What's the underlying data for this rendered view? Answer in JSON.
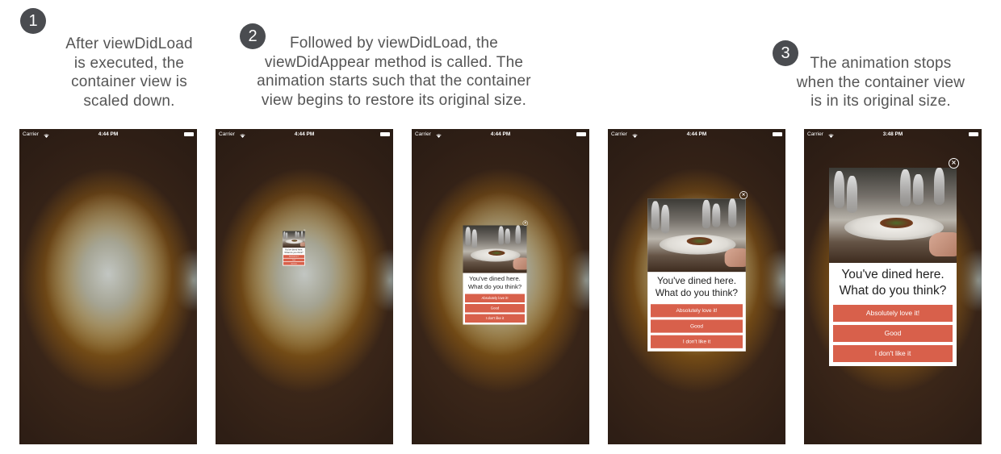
{
  "steps": [
    {
      "number": "1",
      "caption_lines": [
        "After viewDidLoad",
        "is executed, the",
        "container view is",
        "scaled down."
      ]
    },
    {
      "number": "2",
      "caption_lines": [
        "Followed by viewDidLoad, the",
        "viewDidAppear method is called. The",
        "animation starts such that the container",
        "view begins to restore its original size."
      ]
    },
    {
      "number": "3",
      "caption_lines": [
        "The animation stops",
        "when the container view",
        "is in its original size."
      ]
    }
  ],
  "screens": [
    {
      "carrier": "Carrier",
      "time": "4:44 PM",
      "popup_visible": false
    },
    {
      "carrier": "Carrier",
      "time": "4:44 PM",
      "popup_visible": true
    },
    {
      "carrier": "Carrier",
      "time": "4:44 PM",
      "popup_visible": true
    },
    {
      "carrier": "Carrier",
      "time": "4:44 PM",
      "popup_visible": true
    },
    {
      "carrier": "Carrier",
      "time": "3:48 PM",
      "popup_visible": true
    }
  ],
  "popup": {
    "close_icon": "close-circle-icon",
    "question_line1": "You've dined here.",
    "question_line2": "What do you think?",
    "options": [
      "Absolutely love it!",
      "Good",
      "I don't like it"
    ],
    "button_color": "#d8604b"
  }
}
